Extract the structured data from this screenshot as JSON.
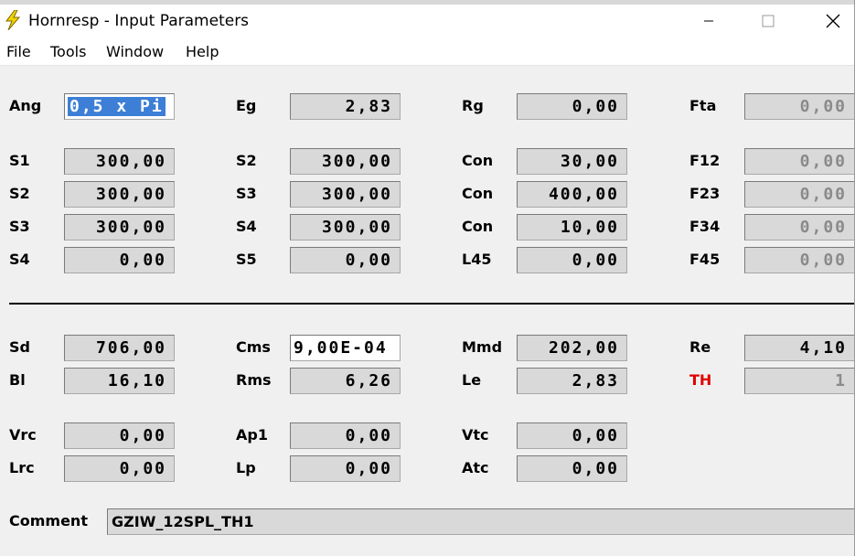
{
  "window": {
    "title": "Hornresp - Input Parameters"
  },
  "menu": [
    "File",
    "Tools",
    "Window",
    "Help"
  ],
  "rows": [
    {
      "name": "ang-row",
      "cells": [
        {
          "label": "Ang",
          "value": "0,5 x Pi",
          "style": "selected"
        },
        {
          "label": "Eg",
          "value": "2,83"
        },
        {
          "label": "Rg",
          "value": "0,00"
        },
        {
          "label": "Fta",
          "value": "0,00",
          "style": "disabled"
        }
      ]
    },
    {
      "name": "s1-row",
      "cells": [
        {
          "label": "S1",
          "value": "300,00"
        },
        {
          "label": "S2",
          "value": "300,00"
        },
        {
          "label": "Con",
          "value": "30,00"
        },
        {
          "label": "F12",
          "value": "0,00",
          "style": "disabled"
        }
      ]
    },
    {
      "name": "s2-row",
      "cells": [
        {
          "label": "S2",
          "value": "300,00"
        },
        {
          "label": "S3",
          "value": "300,00"
        },
        {
          "label": "Con",
          "value": "400,00"
        },
        {
          "label": "F23",
          "value": "0,00",
          "style": "disabled"
        }
      ]
    },
    {
      "name": "s3-row",
      "cells": [
        {
          "label": "S3",
          "value": "300,00"
        },
        {
          "label": "S4",
          "value": "300,00"
        },
        {
          "label": "Con",
          "value": "10,00"
        },
        {
          "label": "F34",
          "value": "0,00",
          "style": "disabled"
        }
      ]
    },
    {
      "name": "s4-row",
      "cells": [
        {
          "label": "S4",
          "value": "0,00"
        },
        {
          "label": "S5",
          "value": "0,00"
        },
        {
          "label": "L45",
          "value": "0,00"
        },
        {
          "label": "F45",
          "value": "0,00",
          "style": "disabled"
        }
      ]
    },
    {
      "name": "sd-row",
      "cells": [
        {
          "label": "Sd",
          "value": "706,00"
        },
        {
          "label": "Cms",
          "value": "9,00E-04",
          "style": "white-left"
        },
        {
          "label": "Mmd",
          "value": "202,00"
        },
        {
          "label": "Re",
          "value": "4,10"
        }
      ]
    },
    {
      "name": "bl-row",
      "cells": [
        {
          "label": "Bl",
          "value": "16,10"
        },
        {
          "label": "Rms",
          "value": "6,26"
        },
        {
          "label": "Le",
          "value": "2,83"
        },
        {
          "label": "TH",
          "value": "1",
          "style": "disabled",
          "label_style": "red"
        }
      ]
    },
    {
      "name": "vrc-row",
      "cells": [
        {
          "label": "Vrc",
          "value": "0,00"
        },
        {
          "label": "Ap1",
          "value": "0,00"
        },
        {
          "label": "Vtc",
          "value": "0,00"
        }
      ]
    },
    {
      "name": "lrc-row",
      "cells": [
        {
          "label": "Lrc",
          "value": "0,00"
        },
        {
          "label": "Lp",
          "value": "0,00"
        },
        {
          "label": "Atc",
          "value": "0,00"
        }
      ]
    }
  ],
  "comment": {
    "label": "Comment",
    "value": "GZIW_12SPL_TH1"
  },
  "colors": {
    "field_bg": "#d9d9d9",
    "selection": "#3d7fd6",
    "th_label": "#e00000",
    "disabled_text": "#8a8a8a"
  }
}
